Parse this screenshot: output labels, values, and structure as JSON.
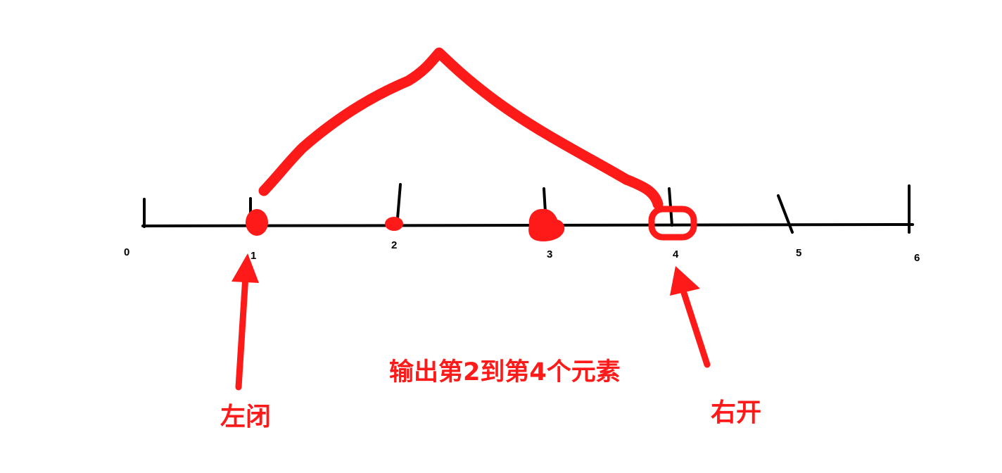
{
  "colors": {
    "ink": "#000000",
    "marker": "#ff1a1a",
    "background": "#ffffff"
  },
  "number_line": {
    "tick_labels": [
      "0",
      "1",
      "2",
      "3",
      "4",
      "5",
      "6"
    ]
  },
  "annotations": {
    "left_label": "左闭",
    "right_label": "右开",
    "caption": "输出第2到第4个元素"
  }
}
